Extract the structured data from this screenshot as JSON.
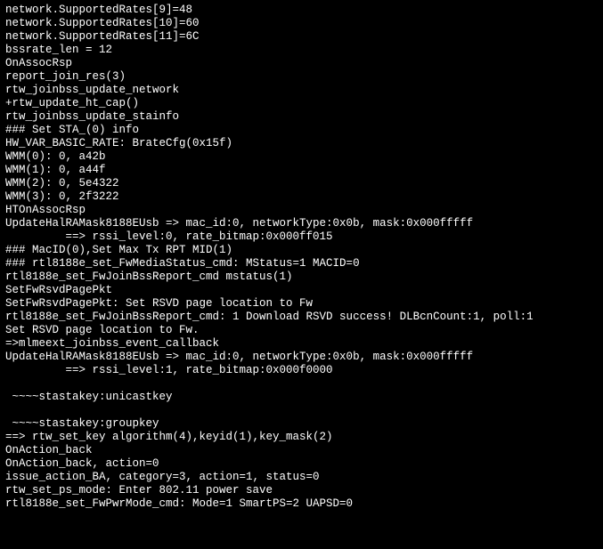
{
  "lines": [
    "network.SupportedRates[9]=48",
    "network.SupportedRates[10]=60",
    "network.SupportedRates[11]=6C",
    "bssrate_len = 12",
    "OnAssocRsp",
    "report_join_res(3)",
    "rtw_joinbss_update_network",
    "+rtw_update_ht_cap()",
    "rtw_joinbss_update_stainfo",
    "### Set STA_(0) info",
    "HW_VAR_BASIC_RATE: BrateCfg(0x15f)",
    "WMM(0): 0, a42b",
    "WMM(1): 0, a44f",
    "WMM(2): 0, 5e4322",
    "WMM(3): 0, 2f3222",
    "HTOnAssocRsp",
    "UpdateHalRAMask8188EUsb => mac_id:0, networkType:0x0b, mask:0x000fffff",
    "         ==> rssi_level:0, rate_bitmap:0x000ff015",
    "### MacID(0),Set Max Tx RPT MID(1)",
    "### rtl8188e_set_FwMediaStatus_cmd: MStatus=1 MACID=0",
    "rtl8188e_set_FwJoinBssReport_cmd mstatus(1)",
    "SetFwRsvdPagePkt",
    "SetFwRsvdPagePkt: Set RSVD page location to Fw",
    "rtl8188e_set_FwJoinBssReport_cmd: 1 Download RSVD success! DLBcnCount:1, poll:1",
    "Set RSVD page location to Fw.",
    "=>mlmeext_joinbss_event_callback",
    "UpdateHalRAMask8188EUsb => mac_id:0, networkType:0x0b, mask:0x000fffff",
    "         ==> rssi_level:1, rate_bitmap:0x000f0000",
    "",
    " ~~~~stastakey:unicastkey",
    "",
    " ~~~~stastakey:groupkey",
    "==> rtw_set_key algorithm(4),keyid(1),key_mask(2)",
    "OnAction_back",
    "OnAction_back, action=0",
    "issue_action_BA, category=3, action=1, status=0",
    "rtw_set_ps_mode: Enter 802.11 power save",
    "rtl8188e_set_FwPwrMode_cmd: Mode=1 SmartPS=2 UAPSD=0"
  ]
}
